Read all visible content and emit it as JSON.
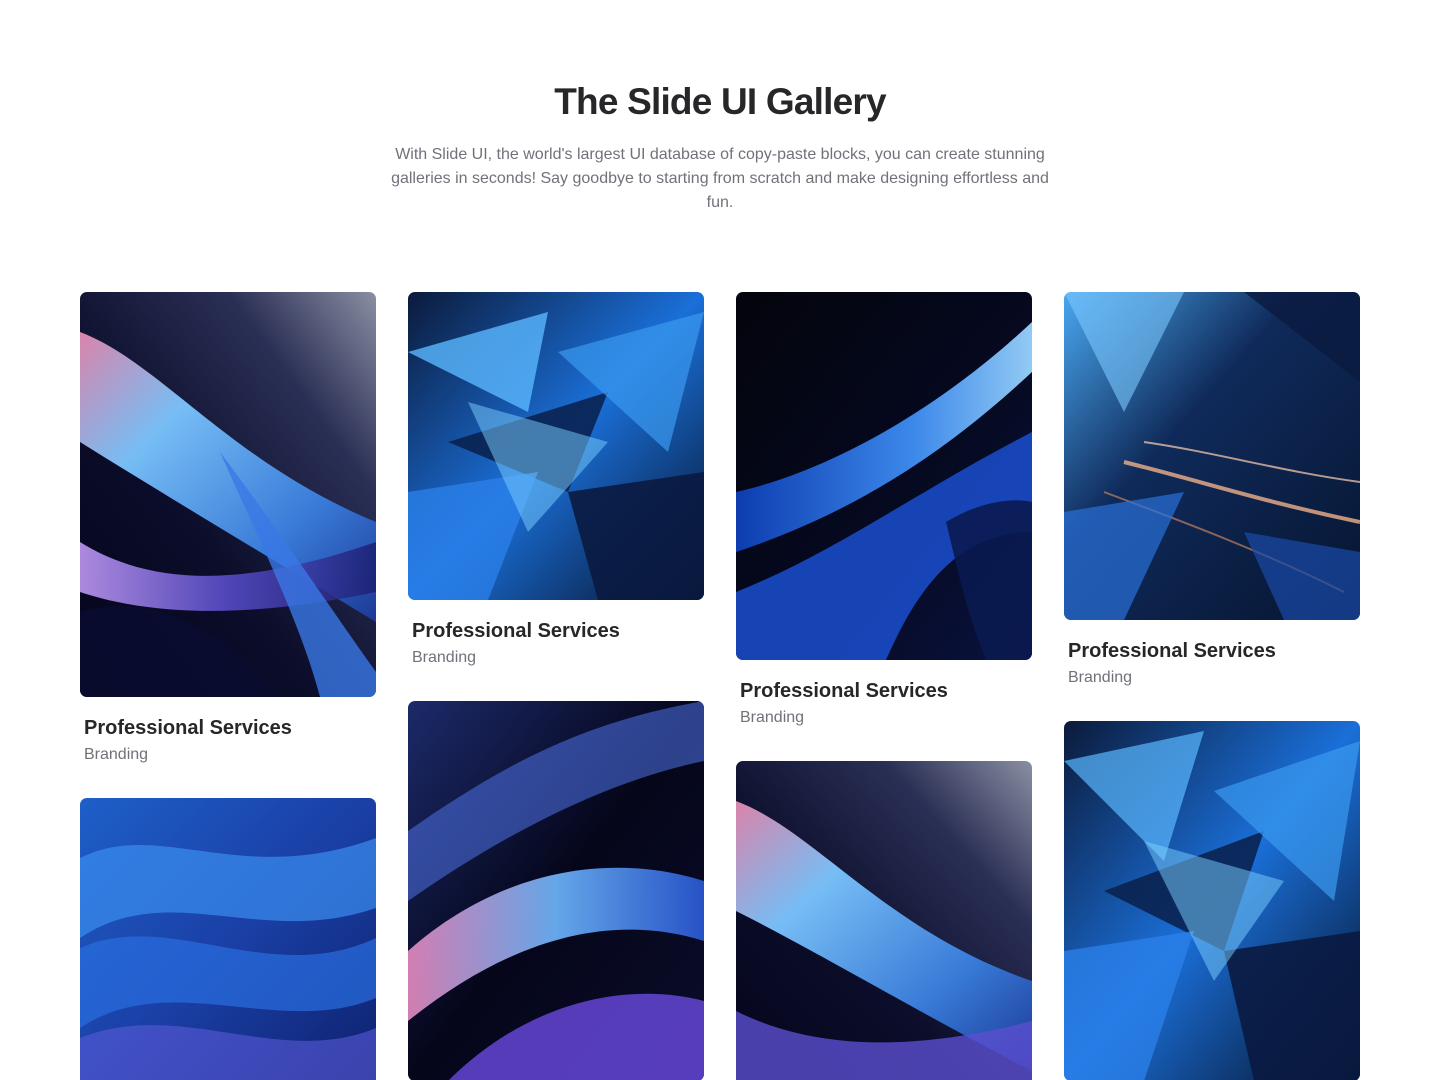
{
  "header": {
    "title": "The Slide UI Gallery",
    "subtitle": "With Slide UI, the world's largest UI database of copy-paste blocks, you can create stunning galleries in seconds! Say goodbye to starting from scratch and make designing effortless and fun."
  },
  "cards": [
    {
      "title": "Professional Services",
      "category": "Branding",
      "image": "abstract-blue-wave"
    },
    {
      "title": "Professional Services",
      "category": "Branding",
      "image": "abstract-blue-shards"
    },
    {
      "title": "Professional Services",
      "category": "Branding",
      "image": "abstract-blue-curve"
    },
    {
      "title": "Professional Services",
      "category": "Branding",
      "image": "abstract-blue-streaks"
    },
    {
      "title": "",
      "category": "",
      "image": "abstract-blue-silk"
    },
    {
      "title": "",
      "category": "",
      "image": "abstract-blue-ribbons"
    },
    {
      "title": "",
      "category": "",
      "image": "abstract-blue-wave"
    },
    {
      "title": "",
      "category": "",
      "image": "abstract-blue-shards"
    }
  ],
  "colors": {
    "heading": "#27272a",
    "muted": "#71717a",
    "background": "#ffffff"
  }
}
